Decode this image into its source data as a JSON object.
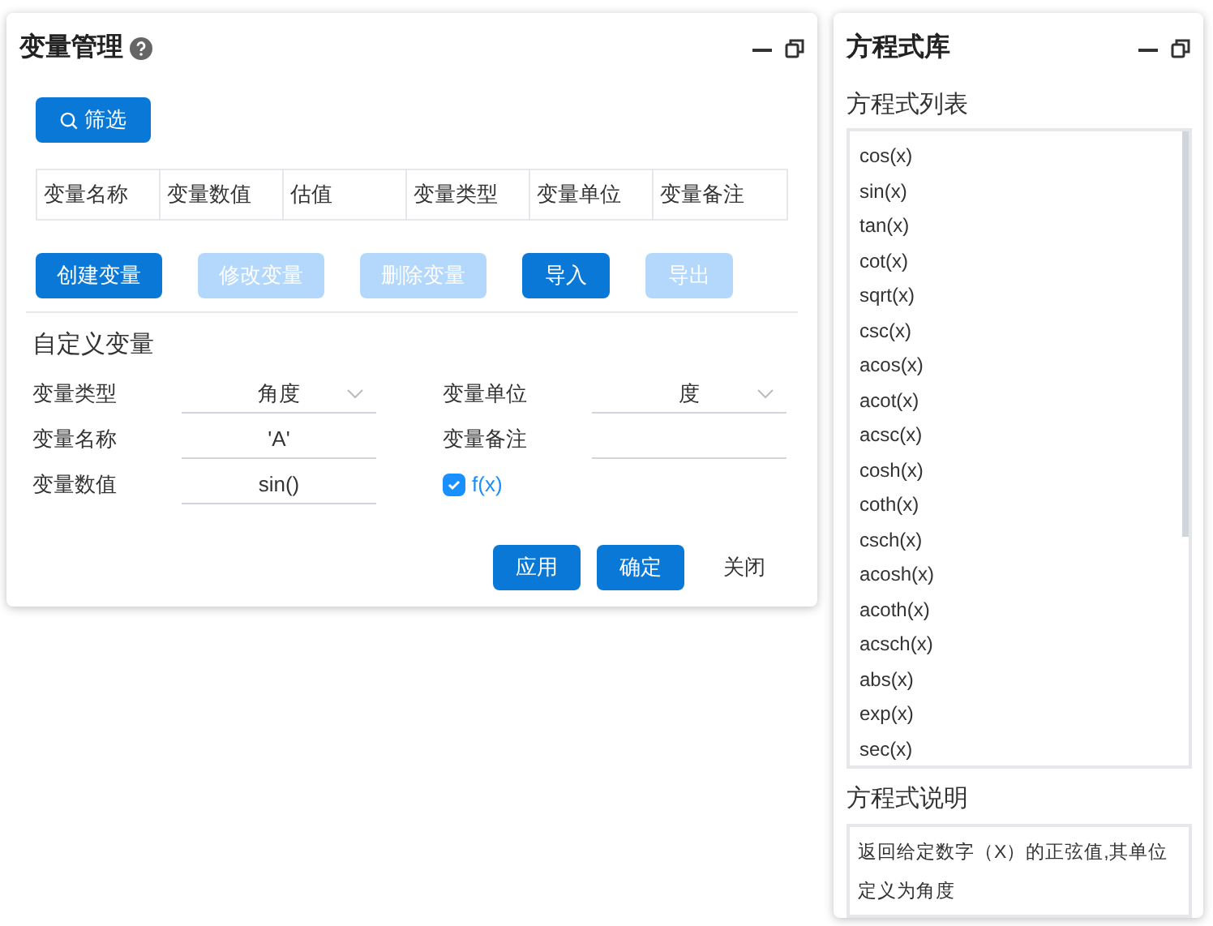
{
  "variable_panel": {
    "title": "变量管理",
    "filter_button": "筛选",
    "table": {
      "columns": [
        "变量名称",
        "变量数值",
        "估值",
        "变量类型",
        "变量单位",
        "变量备注"
      ]
    },
    "actions": [
      {
        "label": "创建变量",
        "disabled": false
      },
      {
        "label": "修改变量",
        "disabled": true
      },
      {
        "label": "删除变量",
        "disabled": true
      },
      {
        "label": "导入",
        "disabled": false
      },
      {
        "label": "导出",
        "disabled": true
      }
    ],
    "section_title": "自定义变量",
    "fields": [
      {
        "kind": "select",
        "label": "变量类型",
        "value": "角度"
      },
      {
        "kind": "select",
        "label": "变量单位",
        "value": "度"
      },
      {
        "kind": "text",
        "label": "变量名称",
        "value": "'A'"
      },
      {
        "kind": "text",
        "label": "变量备注"
      },
      {
        "kind": "text",
        "label": "变量数值",
        "value": "sin()"
      },
      {
        "kind": "checkbox",
        "label": "f(x)",
        "checked": true
      }
    ],
    "footer": [
      {
        "kind": "primary",
        "label": "应用"
      },
      {
        "kind": "primary",
        "label": "确定"
      },
      {
        "kind": "plain",
        "label": "关闭"
      }
    ]
  },
  "equation_panel": {
    "title": "方程式库",
    "list_title": "方程式列表",
    "equations": [
      "cos(x)",
      "sin(x)",
      "tan(x)",
      "cot(x)",
      "sqrt(x)",
      "csc(x)",
      "acos(x)",
      "acot(x)",
      "acsc(x)",
      "cosh(x)",
      "coth(x)",
      "csch(x)",
      "acosh(x)",
      "acoth(x)",
      "acsch(x)",
      "abs(x)",
      "exp(x)",
      "sec(x)"
    ],
    "description_title": "方程式说明",
    "description": "返回给定数字（X）的正弦值,其单位定义为角度"
  }
}
